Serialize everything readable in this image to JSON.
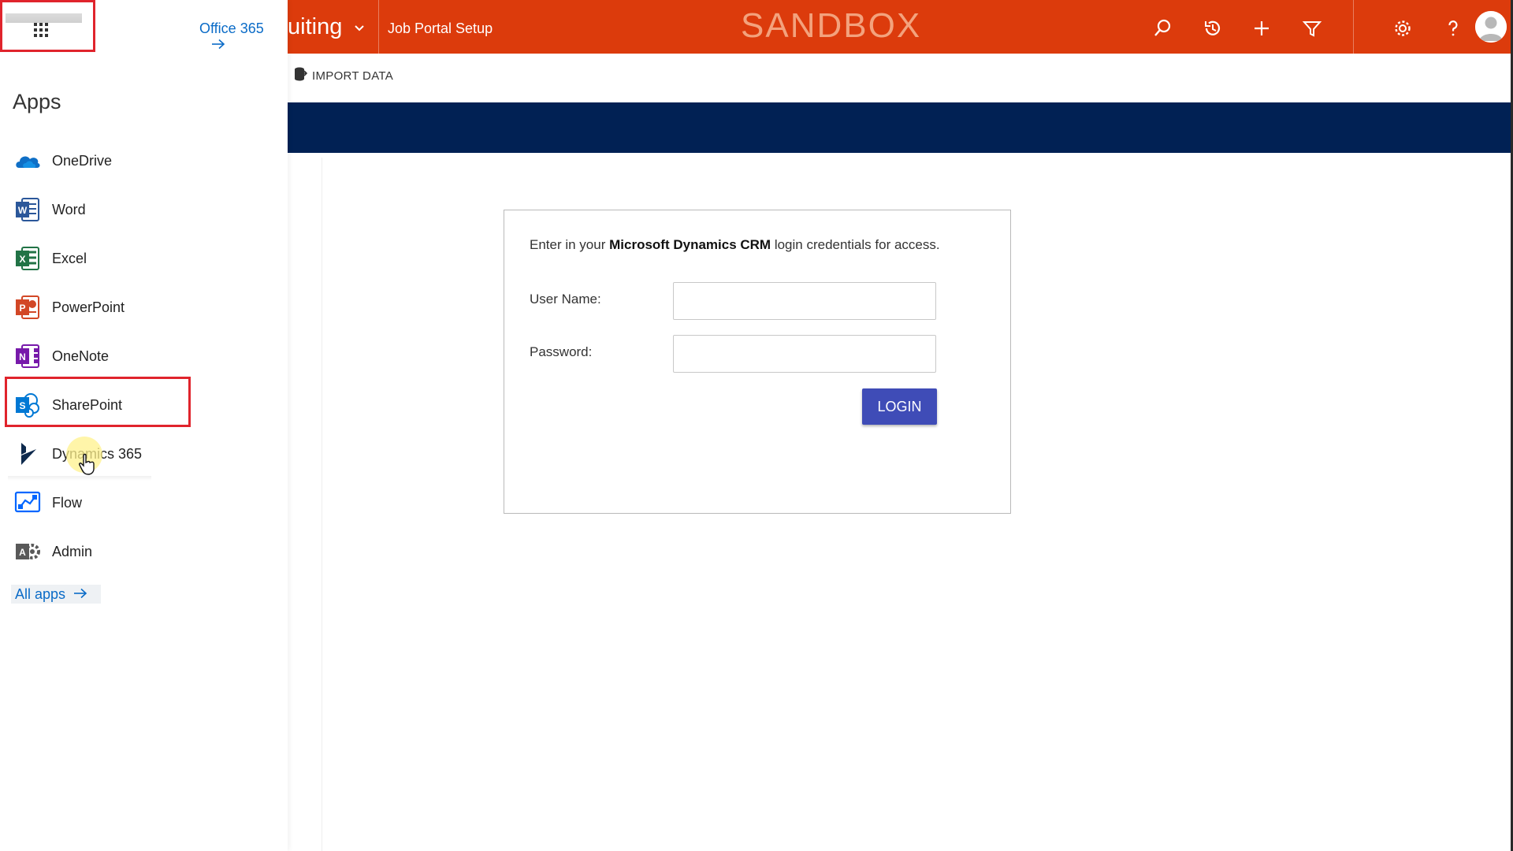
{
  "top_nav": {
    "app_name": "uiting",
    "area_name": "Job Portal Setup",
    "environment_label": "SANDBOX",
    "bar_color": "#dc3b0c",
    "icons": [
      "search-icon",
      "history-icon",
      "plus-icon",
      "filter-icon",
      "gear-icon",
      "help-icon",
      "user-avatar-icon"
    ]
  },
  "command_bar": {
    "import_label": "IMPORT DATA"
  },
  "banner_color": "#012154",
  "login": {
    "intro_pre": "Enter in your ",
    "intro_bold": "Microsoft Dynamics CRM",
    "intro_post": " login credentials for access.",
    "username_label": "User Name:",
    "username_value": "",
    "password_label": "Password:",
    "password_value": "",
    "button_label": "LOGIN",
    "button_color": "#3f4cb7"
  },
  "launcher": {
    "office_link": "Office 365",
    "title": "Apps",
    "apps": [
      {
        "label": "OneDrive",
        "icon": "onedrive-icon"
      },
      {
        "label": "Word",
        "icon": "word-icon"
      },
      {
        "label": "Excel",
        "icon": "excel-icon"
      },
      {
        "label": "PowerPoint",
        "icon": "powerpoint-icon"
      },
      {
        "label": "OneNote",
        "icon": "onenote-icon"
      },
      {
        "label": "SharePoint",
        "icon": "sharepoint-icon"
      },
      {
        "label": "Dynamics 365",
        "icon": "dynamics-icon"
      },
      {
        "label": "Flow",
        "icon": "flow-icon"
      },
      {
        "label": "Admin",
        "icon": "admin-icon"
      }
    ],
    "all_apps_label": "All apps",
    "link_color": "#0a6bc7",
    "highlight_color": "#e0242c"
  }
}
